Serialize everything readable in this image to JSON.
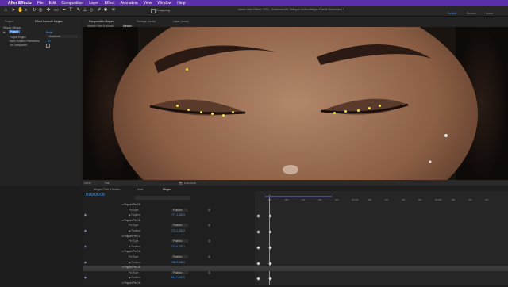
{
  "menubar": {
    "items": [
      "After Effects",
      "File",
      "Edit",
      "Composition",
      "Layer",
      "Effect",
      "Animation",
      "View",
      "Window",
      "Help"
    ]
  },
  "toolbar": {
    "snapping_label": "Snapping",
    "window_title": "Adobe After Effects 2022 - /Volumes/4AV 3/Megan Motion/Megan Plan B Motion.aep *",
    "workspaces": [
      "Default",
      "Review",
      "Learn"
    ],
    "active_workspace": "Default"
  },
  "left_panel": {
    "tabs": [
      "Project",
      "Effect Controls Megan"
    ],
    "breadcrumb": "Megan • Megan",
    "effect_name": "Puppet",
    "reset_label": "Reset",
    "props": [
      {
        "label": "Puppet Engine",
        "value": "Advanced"
      },
      {
        "label": "Mesh Rotation Refinement",
        "value": "20"
      },
      {
        "label": "On Transparent",
        "value": ""
      }
    ]
  },
  "composition": {
    "tab_label": "Composition Megan",
    "subtabs": [
      "Megan Plan B Motion",
      "Megan"
    ],
    "other_tabs": [
      "Footage (none)",
      "Layer (none)"
    ],
    "zoom": "100%",
    "resolution": "Full",
    "timecode": "0:00:00:09"
  },
  "timeline": {
    "tabs": [
      "Megan Plan B Motion",
      "Head",
      "Megan"
    ],
    "timecode": "0:00:00:09",
    "ruler": [
      "00f",
      "05f",
      "10f",
      "15f",
      "20f",
      "01:00f",
      "05f",
      "10f",
      "15f",
      "20f",
      "02:00f",
      "05f",
      "10f",
      "15f"
    ],
    "rows": [
      {
        "label": "Puppet Pin 19",
        "indent": 1,
        "kind": "pin"
      },
      {
        "label": "Pin Type",
        "indent": 2,
        "kind": "type",
        "value": "Position"
      },
      {
        "label": "Position",
        "indent": 2,
        "kind": "pos",
        "value": "771.1,232.5"
      },
      {
        "label": "Puppet Pin 18",
        "indent": 1,
        "kind": "pin"
      },
      {
        "label": "Pin Type",
        "indent": 2,
        "kind": "type",
        "value": "Position"
      },
      {
        "label": "Position",
        "indent": 2,
        "kind": "pos",
        "value": "771.1,232.5"
      },
      {
        "label": "Puppet Pin 17",
        "indent": 1,
        "kind": "pin"
      },
      {
        "label": "Pin Type",
        "indent": 2,
        "kind": "type",
        "value": "Position"
      },
      {
        "label": "Position",
        "indent": 2,
        "kind": "pos",
        "value": "774.6,235.1"
      },
      {
        "label": "Puppet Pin 16",
        "indent": 1,
        "kind": "pin"
      },
      {
        "label": "Pin Type",
        "indent": 2,
        "kind": "type",
        "value": "Position"
      },
      {
        "label": "Position",
        "indent": 2,
        "kind": "pos",
        "value": "784.0,235.0"
      },
      {
        "label": "Puppet Pin 15",
        "indent": 1,
        "kind": "pin",
        "selected": true
      },
      {
        "label": "Pin Type",
        "indent": 2,
        "kind": "type",
        "value": "Position"
      },
      {
        "label": "Position",
        "indent": 2,
        "kind": "pos",
        "value": "811.7,240.9"
      },
      {
        "label": "Puppet Pin 14",
        "indent": 1,
        "kind": "pin"
      }
    ]
  },
  "colors": {
    "menubar": "#5b2fa8",
    "accent": "#3d8fff",
    "playhead": "#4aa3ff",
    "pin": "#f2e24a"
  }
}
